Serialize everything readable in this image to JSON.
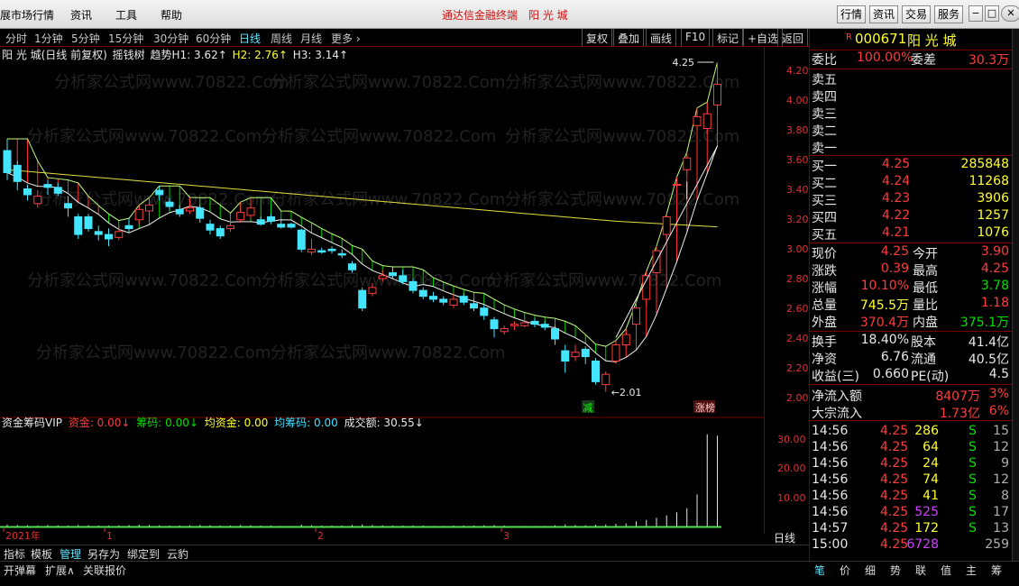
{
  "menu": [
    "展市场行情",
    "资讯",
    "工具",
    "帮助"
  ],
  "app_title": "通达信金融终端　阳 光 城",
  "top_buttons": [
    "行情",
    "资讯",
    "交易",
    "服务"
  ],
  "window_buttons": [
    "−",
    "□",
    "✕"
  ],
  "periods": [
    "分时",
    "1分钟",
    "5分钟",
    "15分钟",
    "30分钟",
    "60分钟",
    "日线",
    "周线",
    "月线",
    "更多 ›"
  ],
  "active_period": "日线",
  "tools": [
    "复权",
    "叠加",
    "画线",
    "F10",
    "标记",
    "+自选",
    "返回"
  ],
  "chart_info": {
    "name": "阳 光 城(日线 前复权)",
    "indicator": "摇钱树",
    "trend": "趋势H1: 3.62↑",
    "h2": "H2: 2.76↑",
    "h3": "H3: 3.14↑"
  },
  "ind2_info": {
    "name": "资金筹码VIP",
    "zj": "资金: 0.00↓",
    "cm": "筹码: 0.00↓",
    "jzj": "均资金: 0.00",
    "jcm": "均筹码: 0.00",
    "cje": "成交额: 30.55↓"
  },
  "annotations": {
    "high": "4.25",
    "low": "2.01",
    "jian": "减",
    "zhangting": "涨榜"
  },
  "y_axis": [
    "4.20",
    "4.00",
    "3.80",
    "3.60",
    "3.40",
    "3.20",
    "3.00",
    "2.80",
    "2.60",
    "2.40",
    "2.20",
    "2.00"
  ],
  "vol_axis": [
    "30.00",
    "20.00",
    "10.00"
  ],
  "x_labels": [
    "2021年",
    "1",
    "2",
    "3"
  ],
  "axis_footer": "日线",
  "watermark": "分析家公式网www.70822.Com",
  "chart_data": {
    "type": "candlestick",
    "ylim": [
      1.88,
      4.33
    ],
    "candles": [
      [
        3.65,
        3.5,
        3.73,
        3.45
      ],
      [
        3.55,
        3.44,
        3.58,
        3.38
      ],
      [
        3.39,
        3.35,
        3.42,
        3.31
      ],
      [
        3.29,
        3.34,
        3.38,
        3.26
      ],
      [
        3.42,
        3.4,
        3.45,
        3.35
      ],
      [
        3.4,
        3.36,
        3.43,
        3.34
      ],
      [
        3.29,
        3.26,
        3.34,
        3.2
      ],
      [
        3.2,
        3.08,
        3.22,
        3.05
      ],
      [
        3.2,
        3.12,
        3.22,
        3.1
      ],
      [
        3.1,
        3.08,
        3.14,
        3.04
      ],
      [
        3.08,
        3.05,
        3.12,
        3.0
      ],
      [
        3.06,
        3.1,
        3.14,
        3.04
      ],
      [
        3.14,
        3.12,
        3.19,
        3.1
      ],
      [
        3.18,
        3.25,
        3.28,
        3.15
      ],
      [
        3.24,
        3.28,
        3.33,
        3.22
      ],
      [
        3.38,
        3.35,
        3.41,
        3.31
      ],
      [
        3.3,
        3.27,
        3.33,
        3.25
      ],
      [
        3.25,
        3.22,
        3.28,
        3.2
      ],
      [
        3.24,
        3.26,
        3.33,
        3.22
      ],
      [
        3.26,
        3.19,
        3.28,
        3.16
      ],
      [
        3.15,
        3.11,
        3.18,
        3.08
      ],
      [
        3.12,
        3.07,
        3.14,
        3.05
      ],
      [
        3.12,
        3.14,
        3.18,
        3.1
      ],
      [
        3.18,
        3.23,
        3.3,
        3.16
      ],
      [
        3.21,
        3.26,
        3.33,
        3.19
      ],
      [
        3.18,
        3.15,
        3.2,
        3.14
      ],
      [
        3.2,
        3.17,
        3.22,
        3.15
      ],
      [
        3.15,
        3.13,
        3.18,
        3.12
      ],
      [
        3.15,
        3.13,
        3.16,
        3.12
      ],
      [
        3.11,
        2.98,
        3.12,
        2.96
      ],
      [
        2.96,
        2.98,
        3.05,
        2.94
      ],
      [
        2.97,
        2.96,
        2.99,
        2.95
      ],
      [
        2.98,
        2.97,
        3.0,
        2.95
      ],
      [
        2.95,
        2.94,
        2.98,
        2.92
      ],
      [
        2.88,
        2.84,
        2.9,
        2.82
      ],
      [
        2.7,
        2.58,
        2.72,
        2.56
      ],
      [
        2.68,
        2.72,
        2.75,
        2.66
      ],
      [
        2.78,
        2.8,
        2.84,
        2.76
      ],
      [
        2.82,
        2.8,
        2.86,
        2.78
      ],
      [
        2.8,
        2.76,
        2.84,
        2.74
      ],
      [
        2.76,
        2.7,
        2.78,
        2.68
      ],
      [
        2.7,
        2.66,
        2.72,
        2.64
      ],
      [
        2.66,
        2.64,
        2.69,
        2.62
      ],
      [
        2.64,
        2.62,
        2.66,
        2.6
      ],
      [
        2.6,
        2.64,
        2.68,
        2.58
      ],
      [
        2.66,
        2.62,
        2.68,
        2.6
      ],
      [
        2.61,
        2.58,
        2.64,
        2.56
      ],
      [
        2.58,
        2.53,
        2.6,
        2.5
      ],
      [
        2.5,
        2.44,
        2.52,
        2.38
      ],
      [
        2.42,
        2.44,
        2.46,
        2.4
      ],
      [
        2.46,
        2.47,
        2.49,
        2.43
      ],
      [
        2.46,
        2.48,
        2.5,
        2.45
      ],
      [
        2.49,
        2.47,
        2.51,
        2.45
      ],
      [
        2.47,
        2.45,
        2.49,
        2.43
      ],
      [
        2.44,
        2.37,
        2.46,
        2.33
      ],
      [
        2.29,
        2.22,
        2.33,
        2.14
      ],
      [
        2.25,
        2.28,
        2.33,
        2.22
      ],
      [
        2.3,
        2.25,
        2.32,
        2.2
      ],
      [
        2.22,
        2.08,
        2.24,
        2.06
      ],
      [
        2.06,
        2.13,
        2.15,
        2.01
      ],
      [
        2.22,
        2.33,
        2.36,
        2.2
      ],
      [
        2.33,
        2.4,
        2.44,
        2.31
      ],
      [
        2.47,
        2.58,
        2.62,
        2.44
      ],
      [
        2.64,
        2.8,
        2.83,
        2.6
      ],
      [
        2.82,
        2.97,
        3.0,
        2.78
      ],
      [
        3.08,
        3.2,
        3.22,
        3.05
      ],
      [
        3.42,
        3.42,
        3.47,
        3.4
      ],
      [
        3.52,
        3.6,
        3.64,
        3.49
      ],
      [
        3.82,
        3.88,
        3.94,
        3.76
      ],
      [
        3.8,
        3.9,
        3.98,
        3.76
      ],
      [
        3.96,
        4.1,
        4.25,
        3.92
      ]
    ],
    "volume": [
      0.9,
      0.8,
      0.7,
      0.6,
      0.8,
      0.7,
      0.6,
      0.8,
      0.7,
      0.6,
      0.6,
      0.7,
      0.8,
      0.9,
      0.8,
      0.7,
      0.6,
      0.6,
      0.7,
      0.8,
      0.7,
      0.6,
      0.6,
      0.8,
      0.7,
      0.6,
      0.6,
      0.5,
      0.5,
      0.9,
      0.7,
      0.6,
      0.6,
      0.6,
      0.8,
      1.0,
      0.8,
      0.7,
      0.6,
      0.6,
      0.6,
      0.6,
      0.5,
      0.5,
      0.6,
      0.6,
      0.6,
      0.7,
      0.8,
      0.6,
      0.5,
      0.5,
      0.5,
      0.5,
      0.7,
      1.0,
      0.8,
      0.7,
      0.9,
      1.0,
      1.2,
      1.3,
      2.0,
      2.5,
      3.2,
      4.0,
      5.0,
      6.4,
      11.0,
      31.0,
      30.5
    ]
  },
  "stock": {
    "code": "000671",
    "name": "阳 光 城",
    "badge": "R"
  },
  "weibi": {
    "label": "委比",
    "value": "100.00%",
    "label2": "委差",
    "value2": "30.3万"
  },
  "asks": [
    {
      "label": "卖五"
    },
    {
      "label": "卖四"
    },
    {
      "label": "卖三"
    },
    {
      "label": "卖二"
    },
    {
      "label": "卖一"
    }
  ],
  "bids": [
    {
      "label": "买一",
      "price": "4.25",
      "vol": "285848"
    },
    {
      "label": "买二",
      "price": "4.24",
      "vol": "11268"
    },
    {
      "label": "买三",
      "price": "4.23",
      "vol": "3906"
    },
    {
      "label": "买四",
      "price": "4.22",
      "vol": "1257"
    },
    {
      "label": "买五",
      "price": "4.21",
      "vol": "1076"
    }
  ],
  "quote": [
    {
      "l1": "现价",
      "v1": "4.25",
      "l2": "今开",
      "v2": "3.90"
    },
    {
      "l1": "涨跌",
      "v1": "0.39",
      "l2": "最高",
      "v2": "4.25"
    },
    {
      "l1": "涨幅",
      "v1": "10.10%",
      "l2": "最低",
      "v2": "3.78"
    },
    {
      "l1": "总量",
      "v1": "745.5万",
      "l2": "量比",
      "v2": "1.18"
    },
    {
      "l1": "外盘",
      "v1": "370.4万",
      "l2": "内盘",
      "v2": "375.1万"
    }
  ],
  "finance": [
    {
      "l1": "换手",
      "v1": "18.40%",
      "l2": "股本",
      "v2": "41.4亿"
    },
    {
      "l1": "净资",
      "v1": "6.76",
      "l2": "流通",
      "v2": "40.5亿"
    },
    {
      "l1": "收益(三)",
      "v1": "0.660",
      "l2": "PE(动)",
      "v2": "4.5"
    }
  ],
  "flows": [
    {
      "label": "净流入额",
      "value": "8407万",
      "pct": "3%"
    },
    {
      "label": "大宗流入",
      "value": "1.73亿",
      "pct": "6%"
    }
  ],
  "ticks": [
    {
      "time": "14:56",
      "price": "4.25",
      "vol": "286",
      "side": "S",
      "n": "15"
    },
    {
      "time": "14:56",
      "price": "4.25",
      "vol": "64",
      "side": "S",
      "n": "12"
    },
    {
      "time": "14:56",
      "price": "4.25",
      "vol": "24",
      "side": "S",
      "n": "9"
    },
    {
      "time": "14:56",
      "price": "4.25",
      "vol": "74",
      "side": "S",
      "n": "12"
    },
    {
      "time": "14:56",
      "price": "4.25",
      "vol": "41",
      "side": "S",
      "n": "8"
    },
    {
      "time": "14:56",
      "price": "4.25",
      "vol": "525",
      "side": "S",
      "n": "17"
    },
    {
      "time": "14:57",
      "price": "4.25",
      "vol": "172",
      "side": "S",
      "n": "13"
    },
    {
      "time": "15:00",
      "price": "4.25",
      "vol": "6728",
      "side": "",
      "n": "259"
    }
  ],
  "bottom_tabs": [
    "指标",
    "模板",
    "管理",
    "另存为",
    "绑定到",
    "云豹"
  ],
  "bottom_tabs2": [
    "开弹幕",
    "扩展∧",
    "关联报价"
  ],
  "side_tabs": [
    "笔",
    "价",
    "细",
    "势",
    "联",
    "值",
    "主",
    "筹"
  ],
  "zoom_buttons": [
    "+",
    "-",
    "○"
  ]
}
